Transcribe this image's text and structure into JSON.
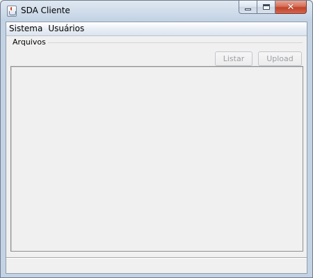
{
  "window": {
    "title": "SDA Cliente",
    "icon": "java-cup-icon",
    "close_symbol": "✕"
  },
  "menubar": {
    "items": [
      "Sistema",
      "Usuários"
    ]
  },
  "files": {
    "section_label": "Arquivos",
    "listar_label": "Listar",
    "upload_label": "Upload"
  },
  "status": {
    "text": ""
  }
}
